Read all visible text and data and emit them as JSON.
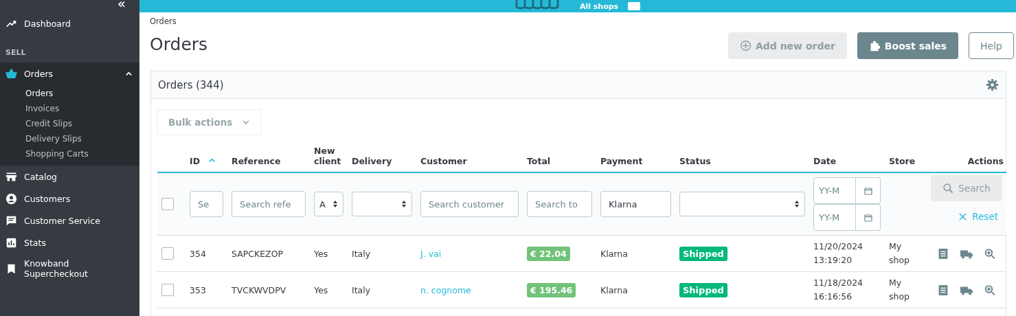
{
  "top_bar": {
    "shop_context": "All shops"
  },
  "sidebar": {
    "collapse": "«",
    "items": [
      {
        "kind": "link",
        "label": "Dashboard",
        "selected": false
      },
      {
        "kind": "section",
        "label": "SELL"
      },
      {
        "kind": "link",
        "label": "Orders",
        "selected": true,
        "expanded": true,
        "children": [
          {
            "label": "Orders",
            "selected": true
          },
          {
            "label": "Invoices",
            "selected": false
          },
          {
            "label": "Credit Slips",
            "selected": false
          },
          {
            "label": "Delivery Slips",
            "selected": false
          },
          {
            "label": "Shopping Carts",
            "selected": false
          }
        ]
      },
      {
        "kind": "link",
        "label": "Catalog",
        "selected": false
      },
      {
        "kind": "link",
        "label": "Customers",
        "selected": false
      },
      {
        "kind": "link",
        "label": "Customer Service",
        "selected": false
      },
      {
        "kind": "link",
        "label": "Stats",
        "selected": false
      },
      {
        "kind": "link",
        "label": "Knowband Supercheckout",
        "selected": false
      }
    ]
  },
  "breadcrumb": "Orders",
  "page_title": "Orders",
  "toolbar": [
    {
      "kind": "add",
      "label": "Add new order",
      "disabled": true
    },
    {
      "kind": "boost",
      "label": "Boost sales",
      "disabled": false
    },
    {
      "kind": "help",
      "label": "Help",
      "disabled": false
    }
  ],
  "panel": {
    "title": "Orders (344)",
    "bulk_actions": {
      "label": "Bulk actions",
      "disabled": true
    },
    "table": {
      "columns": [
        {},
        {
          "label": "ID",
          "sorted": true
        },
        {
          "label": "Reference"
        },
        {
          "label": "New client"
        },
        {
          "label": "Delivery"
        },
        {
          "label": "Customer"
        },
        {
          "label": "Total"
        },
        {
          "label": "Payment"
        },
        {
          "label": "Status"
        },
        {
          "label": "Date"
        },
        {
          "label": "Store"
        },
        {
          "label": "Actions"
        }
      ],
      "filters": [
        {
          "kind": "checkbox",
          "checked": false
        },
        {
          "kind": "input",
          "placeholder": "Se"
        },
        {
          "kind": "input",
          "placeholder": "Search refe"
        },
        {
          "kind": "select",
          "value": "A"
        },
        {
          "kind": "select"
        },
        {
          "kind": "input",
          "placeholder": "Search customer"
        },
        {
          "kind": "input",
          "placeholder": "Search to"
        },
        {
          "kind": "input",
          "value": "Klarna"
        },
        {
          "kind": "select"
        },
        {
          "kind": "date",
          "from_placeholder": "YY-M",
          "to_placeholder": "YY-M"
        },
        {
          "kind": "empty"
        },
        {
          "kind": "actions",
          "search": "Search",
          "reset": "Reset"
        }
      ],
      "rows": [
        {
          "checked": false,
          "id": "354",
          "reference": "SAPCKEZOP",
          "new_client": "Yes",
          "delivery": "Italy",
          "customer": "J. vai",
          "total": "€ 22.04",
          "payment": "Klarna",
          "status": "Shipped",
          "color": "#00b87a",
          "date": "11/20/2024 13:19:20",
          "store": "My shop"
        },
        {
          "checked": false,
          "id": "353",
          "reference": "TVCKWVDPV",
          "new_client": "Yes",
          "delivery": "Italy",
          "customer": "n. cognome",
          "total": "€ 195.46",
          "payment": "Klarna",
          "status": "Shipped",
          "color": "#00b87a",
          "date": "11/18/2024 16:16:56",
          "store": "My shop"
        }
      ]
    }
  }
}
